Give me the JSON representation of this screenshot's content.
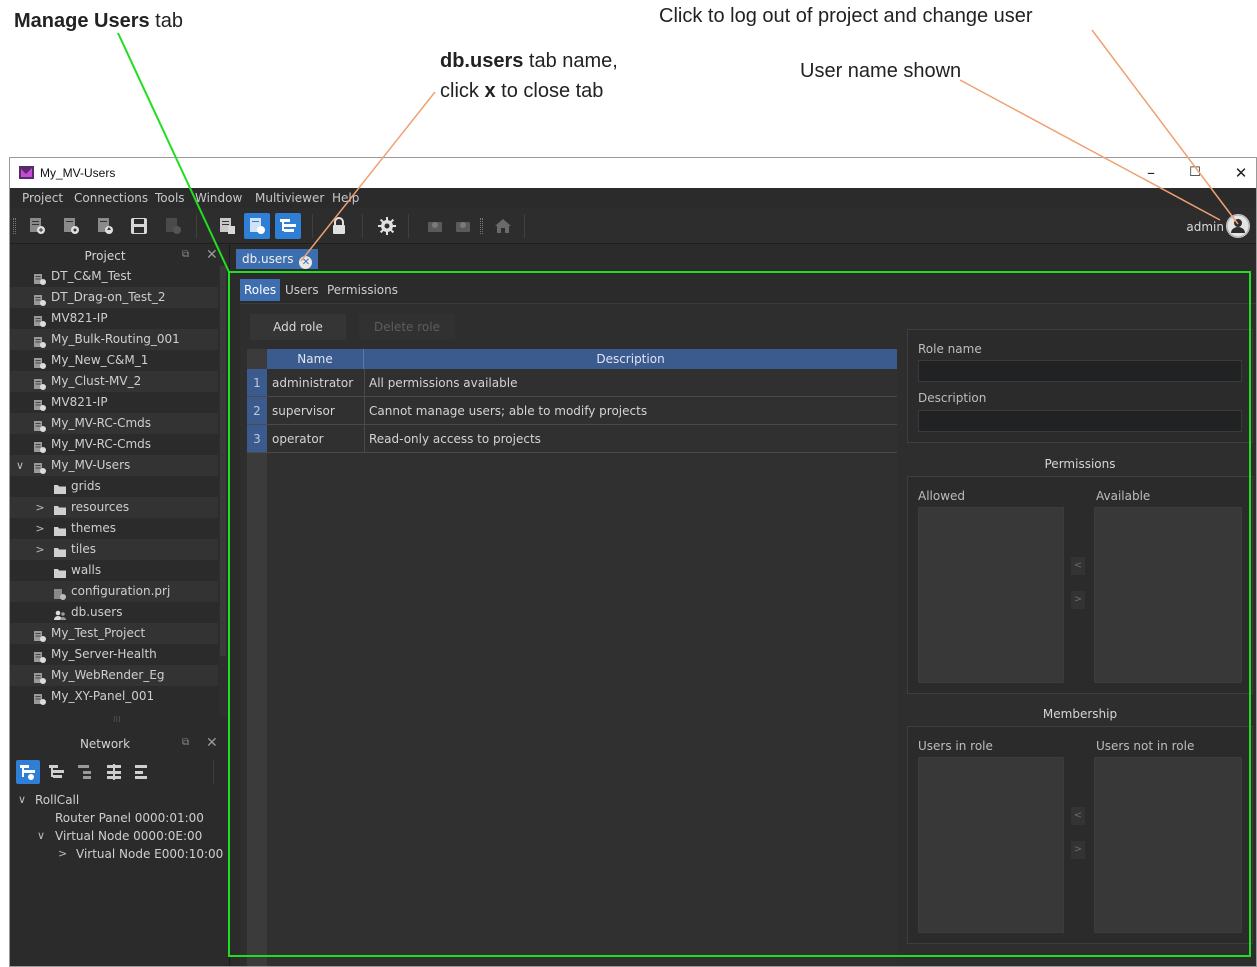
{
  "annotations": {
    "manage_users_bold": "Manage Users",
    "manage_users_rest": " tab",
    "tab_name_bold": "db.users",
    "tab_name_rest": " tab name,",
    "tab_close_pre": "click ",
    "tab_close_bold": "x",
    "tab_close_rest": " to close tab",
    "user_name": "User name shown",
    "logout": "Click to log out of project and change user",
    "callout_green": "#22dd22",
    "callout_orange": "#f0a070"
  },
  "window": {
    "title": "My_MV-Users",
    "minimize": "–",
    "maximize": "☐",
    "close": "✕"
  },
  "menu": [
    "Project",
    "Connections",
    "Tools",
    "Window",
    "Multiviewer",
    "Help"
  ],
  "toolbar": {
    "user": "admin",
    "accent": "#2f7fd6"
  },
  "project_panel": {
    "title": "Project",
    "items": [
      {
        "label": "DT_C&M_Test",
        "icon": "project-icon"
      },
      {
        "label": "DT_Drag-on_Test_2",
        "icon": "project-icon"
      },
      {
        "label": "MV821-IP",
        "icon": "project-icon"
      },
      {
        "label": "My_Bulk-Routing_001",
        "icon": "project-icon"
      },
      {
        "label": "My_New_C&M_1",
        "icon": "project-icon"
      },
      {
        "label": "My_Clust-MV_2",
        "icon": "project-icon"
      },
      {
        "label": "MV821-IP",
        "icon": "project-icon"
      },
      {
        "label": "My_MV-RC-Cmds",
        "icon": "project-icon"
      },
      {
        "label": "My_MV-RC-Cmds",
        "icon": "project-icon"
      },
      {
        "label": "My_MV-Users",
        "icon": "project-icon"
      },
      {
        "label": "grids",
        "icon": "folder-icon"
      },
      {
        "label": "resources",
        "icon": "folder-icon"
      },
      {
        "label": "themes",
        "icon": "folder-icon"
      },
      {
        "label": "tiles",
        "icon": "folder-icon"
      },
      {
        "label": "walls",
        "icon": "folder-icon"
      },
      {
        "label": "configuration.prj",
        "icon": "project-file-icon"
      },
      {
        "label": "db.users",
        "icon": "users-icon"
      },
      {
        "label": "My_Test_Project",
        "icon": "project-icon"
      },
      {
        "label": "My_Server-Health",
        "icon": "project-icon"
      },
      {
        "label": "My_WebRender_Eg",
        "icon": "project-icon"
      },
      {
        "label": "My_XY-Panel_001",
        "icon": "project-icon"
      }
    ]
  },
  "network_panel": {
    "title": "Network",
    "items": [
      {
        "label": "RollCall"
      },
      {
        "label": "Router Panel 0000:01:00"
      },
      {
        "label": "Virtual Node 0000:0E:00"
      },
      {
        "label": "Virtual Node E000:10:00"
      }
    ]
  },
  "doc_tab": {
    "label": "db.users",
    "close_glyph": "✕"
  },
  "subtabs": [
    "Roles",
    "Users",
    "Permissions"
  ],
  "roles": {
    "add_button": "Add role",
    "delete_button": "Delete role",
    "columns": [
      "Name",
      "Description"
    ],
    "rows": [
      {
        "num": "1",
        "name": "administrator",
        "description": "All permissions available"
      },
      {
        "num": "2",
        "name": "supervisor",
        "description": "Cannot manage users; able to modify projects"
      },
      {
        "num": "3",
        "name": "operator",
        "description": "Read-only access to projects"
      }
    ],
    "role_name_label": "Role name",
    "description_label": "Description",
    "permissions_title": "Permissions",
    "allowed_label": "Allowed",
    "available_label": "Available",
    "membership_title": "Membership",
    "users_in_role_label": "Users in role",
    "users_not_in_role_label": "Users not in role",
    "move_left": "<",
    "move_right": ">"
  }
}
